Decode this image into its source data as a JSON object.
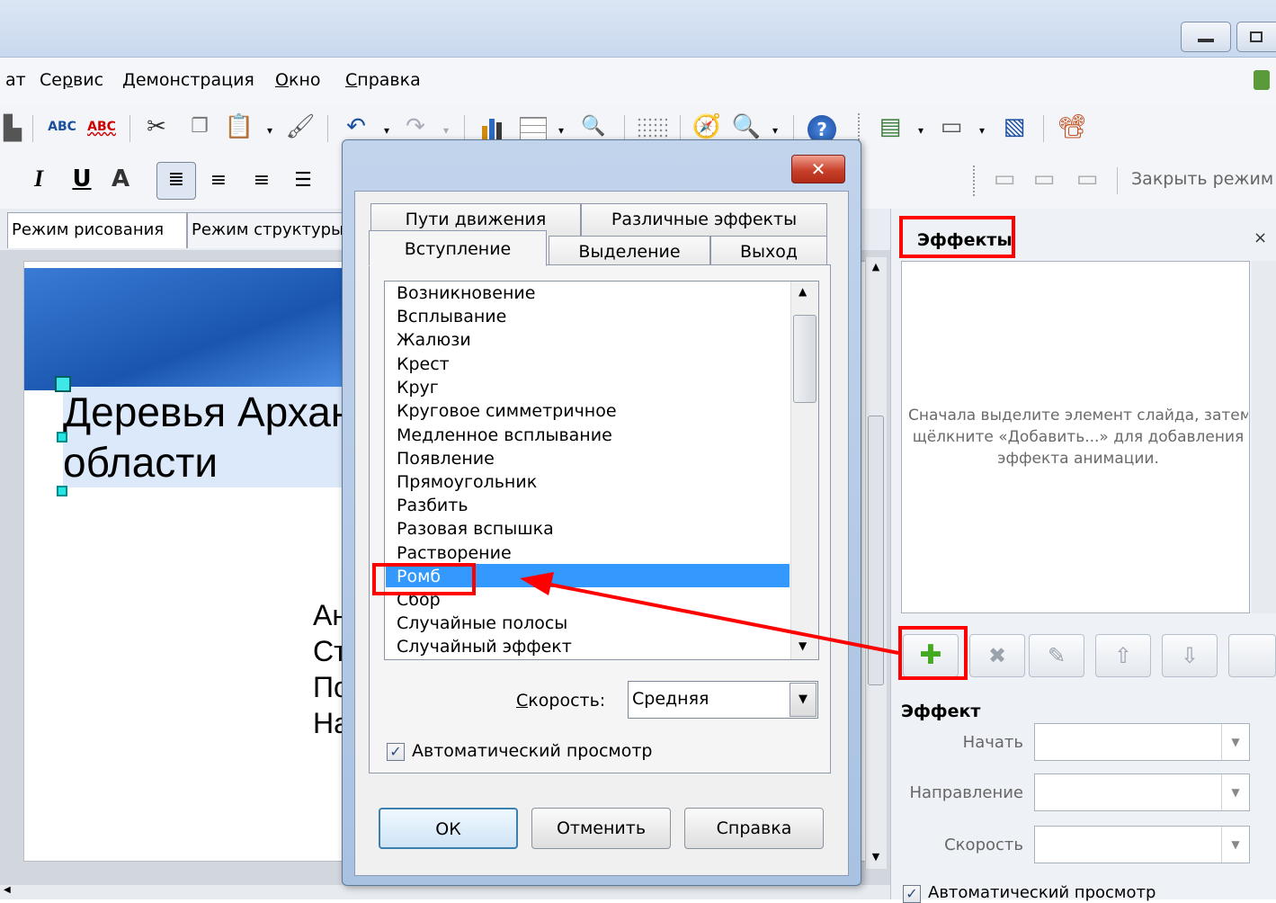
{
  "menu": {
    "items": [
      {
        "pre": "",
        "ul": "",
        "post": "ат"
      },
      {
        "pre": "Се",
        "ul": "р",
        "post": "вис"
      },
      {
        "pre": "",
        "ul": "Д",
        "post": "емонстрация"
      },
      {
        "pre": "",
        "ul": "О",
        "post": "кно"
      },
      {
        "pre": "",
        "ul": "С",
        "post": "правка"
      }
    ]
  },
  "toolbar2": {
    "close_mode_label": "Закрыть режим"
  },
  "doc_tabs": {
    "drawing": "Режим рисования",
    "outline": "Режим структуры"
  },
  "slide": {
    "title_line1": "Деревья Архангельской",
    "title_line2": "области",
    "body_lines": [
      "Ан",
      "Ст",
      "По",
      "На"
    ]
  },
  "sidebar": {
    "header": "Эффекты",
    "hint": "Сначала выделите элемент слайда, затем\nщёлкните «Добавить...» для добавления\nэффекта анимации.",
    "effect_section": "Эффект",
    "start_label": "Начать",
    "direction_label": "Направление",
    "speed_label": "Скорость",
    "autopreview": "Автоматический просмотр"
  },
  "dialog": {
    "tabs_back": [
      "Пути движения",
      "Различные эффекты"
    ],
    "tabs_front": [
      "Вступление",
      "Выделение",
      "Выход"
    ],
    "active_tab": "Вступление",
    "effects": [
      "Возникновение",
      "Всплывание",
      "Жалюзи",
      "Крест",
      "Круг",
      "Круговое симметричное",
      "Медленное всплывание",
      "Появление",
      "Прямоугольник",
      "Разбить",
      "Разовая вспышка",
      "Растворение",
      "Ромб",
      "Сбор",
      "Случайные полосы",
      "Случайный эффект"
    ],
    "selected_effect": "Ромб",
    "speed_label": "Скорость:",
    "speed_value": "Средняя",
    "autopreview_label": "Автоматический просмотр",
    "autopreview_checked": true,
    "ok_label": "ОК",
    "cancel_label": "Отменить",
    "help_label": "Справка",
    "close_glyph": "✕"
  },
  "colors": {
    "selection": "#3399ff",
    "annotation": "#ff0000",
    "add_icon": "#44aa22"
  }
}
